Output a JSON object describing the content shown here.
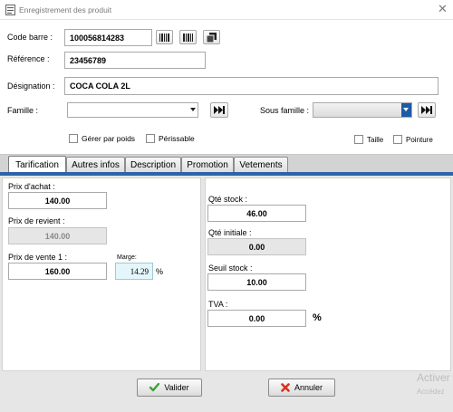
{
  "window": {
    "title": "Enregistrement des produit",
    "close_icon": "✕"
  },
  "form": {
    "barcode": {
      "label": "Code barre :",
      "value": "100056814283"
    },
    "reference": {
      "label": "Référence :",
      "value": "23456789"
    },
    "designation": {
      "label": "Désignation :",
      "value": "COCA COLA 2L"
    },
    "famille": {
      "label": "Famille :",
      "value": ""
    },
    "sous_famille": {
      "label": "Sous famille :",
      "value": ""
    },
    "checkboxes": {
      "gerer_par_poids": "Gérer par poids",
      "perissable": "Périssable",
      "taille": "Taille",
      "pointure": "Pointure"
    }
  },
  "tabs": [
    {
      "label": "Tarification",
      "active": true
    },
    {
      "label": "Autres infos",
      "active": false
    },
    {
      "label": "Description",
      "active": false
    },
    {
      "label": "Promotion",
      "active": false
    },
    {
      "label": "Vetements",
      "active": false
    }
  ],
  "tarification": {
    "prix_achat": {
      "label": "Prix d'achat :",
      "value": "140.00"
    },
    "prix_revient": {
      "label": "Prix de revient :",
      "value": "140.00"
    },
    "prix_vente": {
      "label": "Prix de vente 1 :",
      "value": "160.00"
    },
    "marge": {
      "label": "Marge:",
      "value": "14.29",
      "unit": "%"
    },
    "qte_stock": {
      "label": "Qté stock :",
      "value": "46.00"
    },
    "qte_initiale": {
      "label": "Qté initiale :",
      "value": "0.00"
    },
    "seuil_stock": {
      "label": "Seuil stock :",
      "value": "10.00"
    },
    "tva": {
      "label": "TVA :",
      "value": "0.00",
      "unit": "%"
    }
  },
  "actions": {
    "valider": "Valider",
    "annuler": "Annuler"
  },
  "watermark": {
    "line1": "Activer",
    "line2": "Accédez"
  },
  "colors": {
    "tab_accent": "#2e63a8",
    "valider_check": "#3aa335",
    "annuler_x": "#d9321f"
  }
}
